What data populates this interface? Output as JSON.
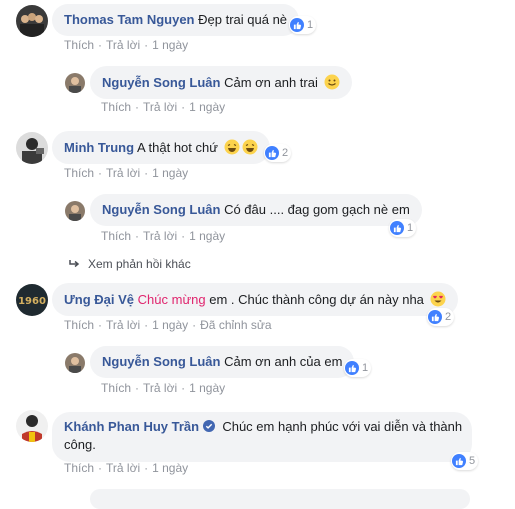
{
  "actions": {
    "like": "Thích",
    "reply": "Trả lời",
    "dot": "·"
  },
  "comments": [
    {
      "name": "Thomas Tam Nguyen",
      "text": "Đẹp trai quá nè",
      "time": "1 ngày",
      "likes": "1"
    },
    {
      "name": "Nguyễn Song Luân",
      "text": "Cảm ơn anh trai",
      "time": "1 ngày"
    },
    {
      "name": "Minh Trung",
      "text": "A thật hot chứ",
      "time": "1 ngày",
      "likes": "2"
    },
    {
      "name": "Nguyễn Song Luân",
      "text": "Có đâu .... đag gom gạch nè em",
      "time": "1 ngày",
      "likes": "1"
    },
    {
      "name": "Ưng Đại Vệ",
      "highlight": "Chúc mừng",
      "text": "em . Chúc thành công dự án này nha",
      "time": "1 ngày",
      "edited": "Đã chỉnh sửa",
      "likes": "2",
      "avatar_text": "1960"
    },
    {
      "name": "Nguyễn Song Luân",
      "text": "Cảm ơn anh của em",
      "time": "1 ngày",
      "likes": "1"
    },
    {
      "name": "Khánh Phan Huy Trần",
      "text_line1": "Chúc em hạnh phúc với vai diễn và thành",
      "text_line2": "công.",
      "time": "1 ngày",
      "likes": "5"
    }
  ],
  "more_replies": "Xem phản hồi khác",
  "icons": [
    "like-icon",
    "smile-emoji-icon",
    "laugh-emoji-icon",
    "heart-eyes-emoji-icon",
    "reply-arrow-icon",
    "verified-badge-icon"
  ],
  "colors": {
    "name": "#385898",
    "bubble": "#f2f3f5",
    "like": "#4080ff",
    "highlight": "#e0256e",
    "meta": "#90949c"
  }
}
